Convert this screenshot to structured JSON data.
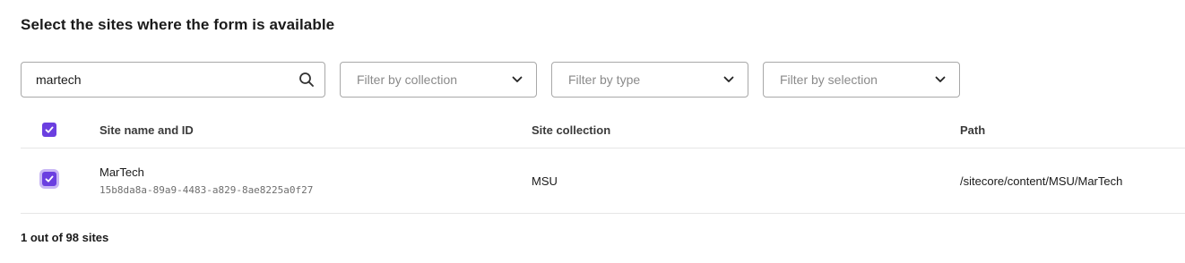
{
  "title": "Select the sites where the form is available",
  "search": {
    "value": "martech"
  },
  "filters": {
    "collection_placeholder": "Filter by collection",
    "type_placeholder": "Filter by type",
    "selection_placeholder": "Filter by selection"
  },
  "table": {
    "headers": [
      "Site name and ID",
      "Site collection",
      "Path"
    ],
    "select_all_checked": true,
    "rows": [
      {
        "checked": true,
        "name": "MarTech",
        "id": "15b8da8a-89a9-4483-a829-8ae8225a0f27",
        "collection": "MSU",
        "path": "/sitecore/content/MSU/MarTech"
      }
    ]
  },
  "footer": {
    "count": "1 out of 98 sites"
  },
  "colors": {
    "accent": "#6b3fe0",
    "focus_ring": "#c9b7f5"
  },
  "icons": [
    "search-icon",
    "chevron-down-icon",
    "checkmark-icon"
  ]
}
